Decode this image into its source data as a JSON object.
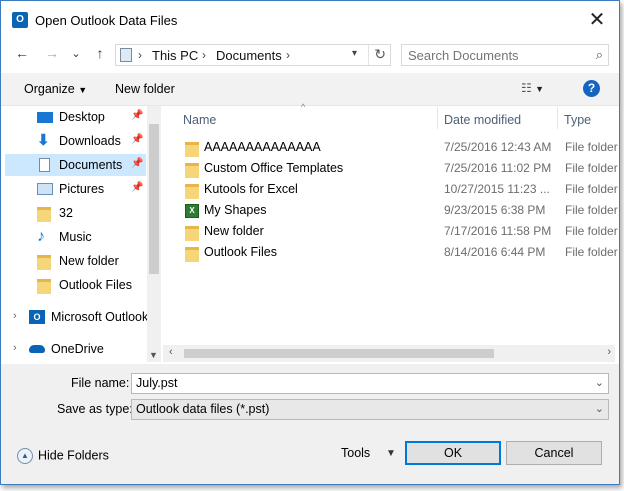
{
  "window": {
    "title": "Open Outlook Data Files",
    "app_icon": "outlook-icon",
    "close_glyph": "✕"
  },
  "nav_buttons": {
    "back": "←",
    "forward": "→",
    "recent": "⌄",
    "up": "↑"
  },
  "address_bar": {
    "crumbs": [
      "This PC",
      "Documents"
    ],
    "separator": "›"
  },
  "search": {
    "placeholder": "Search Documents"
  },
  "toolbar": {
    "organize_label": "Organize",
    "new_folder_label": "New folder"
  },
  "nav_pane": {
    "items": [
      {
        "label": "Desktop",
        "icon": "desktop-icon",
        "pinned": true
      },
      {
        "label": "Downloads",
        "icon": "downloads-icon",
        "pinned": true
      },
      {
        "label": "Documents",
        "icon": "documents-icon",
        "pinned": true,
        "selected": true
      },
      {
        "label": "Pictures",
        "icon": "pictures-icon",
        "pinned": true
      },
      {
        "label": "32",
        "icon": "folder-icon"
      },
      {
        "label": "Music",
        "icon": "music-icon"
      },
      {
        "label": "New folder",
        "icon": "folder-icon"
      },
      {
        "label": "Outlook Files",
        "icon": "folder-icon"
      },
      {
        "label": "Microsoft Outlook",
        "icon": "outlook-icon",
        "expandable": true
      },
      {
        "label": "OneDrive",
        "icon": "onedrive-icon",
        "expandable": true
      }
    ]
  },
  "file_list": {
    "columns": [
      "Name",
      "Date modified",
      "Type"
    ],
    "rows": [
      {
        "name": "AAAAAAAAAAAAAA",
        "date": "7/25/2016 12:43 AM",
        "type": "File folder",
        "icon": "folder-icon"
      },
      {
        "name": "Custom Office Templates",
        "date": "7/25/2016 11:02 PM",
        "type": "File folder",
        "icon": "folder-icon"
      },
      {
        "name": "Kutools for Excel",
        "date": "10/27/2015 11:23 ...",
        "type": "File folder",
        "icon": "folder-icon"
      },
      {
        "name": "My Shapes",
        "date": "9/23/2015 6:38 PM",
        "type": "File folder",
        "icon": "excel-shapes-icon"
      },
      {
        "name": "New folder",
        "date": "7/17/2016 11:58 PM",
        "type": "File folder",
        "icon": "folder-icon"
      },
      {
        "name": "Outlook Files",
        "date": "8/14/2016 6:44 PM",
        "type": "File folder",
        "icon": "folder-icon"
      }
    ]
  },
  "bottom": {
    "file_name_label": "File name:",
    "file_name_value": "July.pst",
    "save_as_type_label": "Save as type:",
    "save_as_type_value": "Outlook data files (*.pst)",
    "hide_folders_label": "Hide Folders",
    "tools_label": "Tools",
    "ok_label": "OK",
    "cancel_label": "Cancel"
  },
  "colors": {
    "selection": "#cce8ff",
    "accent": "#0078d7",
    "help": "#1565c0"
  }
}
